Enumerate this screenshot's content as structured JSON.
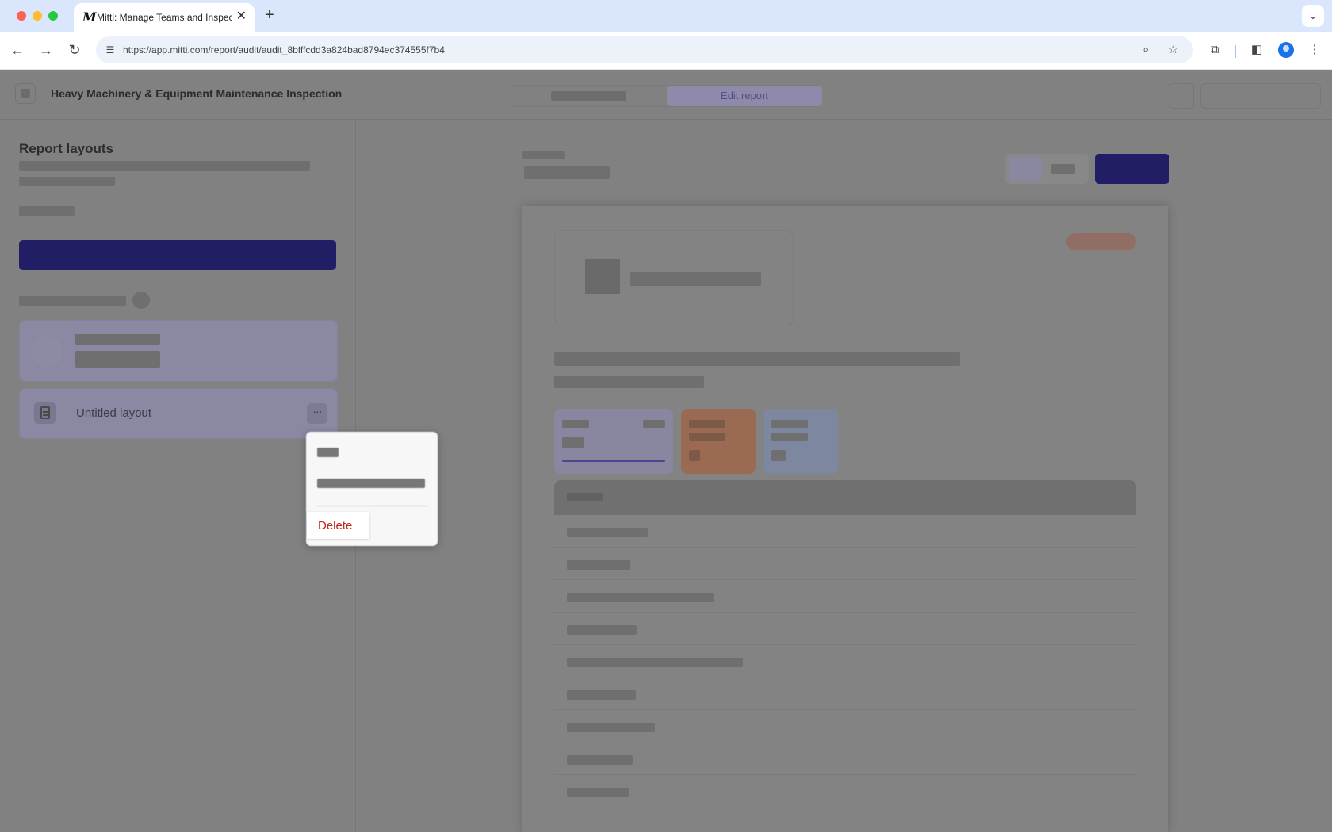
{
  "browser": {
    "tab_title": "Mitti: Manage Teams and Inspect...",
    "favicon": "M",
    "url": "https://app.mitti.com/report/audit/audit_8bfffcdd3a824bad8794ec374555f7b4",
    "icons": [
      "back-icon",
      "forward-icon",
      "reload-icon",
      "site-settings-icon",
      "zoom-icon",
      "bookmark-star-icon",
      "extensions-icon",
      "side-panel-icon",
      "profile-icon",
      "menu-icon",
      "tab-search-icon",
      "new-tab-icon",
      "close-tab-icon"
    ]
  },
  "header": {
    "title": "Heavy Machinery & Equipment Maintenance Inspection",
    "edit_report": "Edit report"
  },
  "sidebar": {
    "title": "Report layouts",
    "layouts": [
      {
        "label": "Untitled layout"
      }
    ]
  },
  "context_menu": {
    "delete_label": "Delete"
  },
  "colors": {
    "primary": "#221e66",
    "delete": "#c0281c",
    "overlay": "#818181"
  }
}
